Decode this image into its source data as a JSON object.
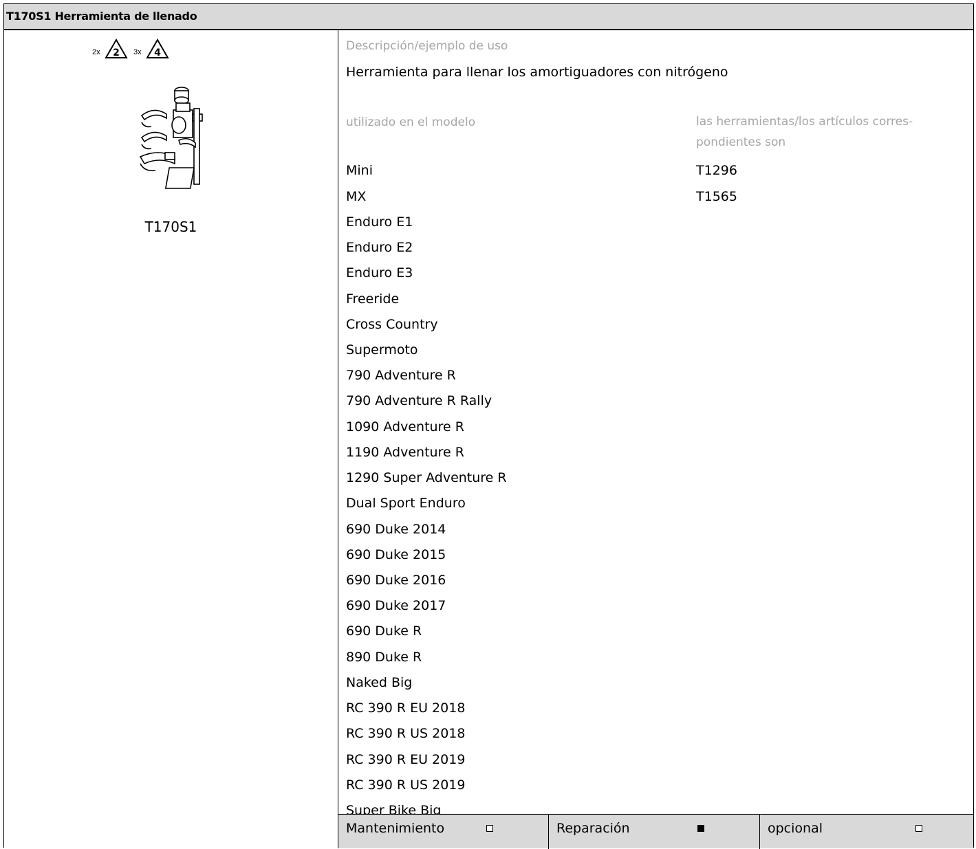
{
  "header": {
    "title": "T170S1 Herramienta de llenado"
  },
  "tool": {
    "warning_icons": [
      {
        "multiplier": "2x",
        "number": "2"
      },
      {
        "multiplier": "3x",
        "number": "4"
      }
    ],
    "name": "T170S1"
  },
  "description": {
    "label": "Descripción/ejemplo de uso",
    "value": "Herramienta para llenar los amortiguadores con nitrógeno"
  },
  "used_in": {
    "label": "utilizado en el modelo",
    "models": [
      "Mini",
      "MX",
      "Enduro E1",
      "Enduro E2",
      "Enduro E3",
      "Freeride",
      "Cross Country",
      "Supermoto",
      "790 Adventure R",
      "790 Adventure R Rally",
      "1090 Adventure R",
      "1190 Adventure R",
      "1290 Super Adventure R",
      "Dual Sport Enduro",
      "690 Duke 2014",
      "690 Duke 2015",
      "690 Duke 2016",
      "690 Duke 2017",
      "690 Duke R",
      "890 Duke R",
      "Naked Big",
      "RC 390 R EU 2018",
      "RC 390 R US 2018",
      "RC 390 R EU 2019",
      "RC 390 R US 2019",
      "Super Bike Big"
    ]
  },
  "corresponding": {
    "label_line1": "las herramientas/los artículos corres-",
    "label_line2": "pondientes son",
    "items": [
      "T1296",
      "T1565"
    ]
  },
  "footer": {
    "cells": [
      {
        "label": "Mantenimiento",
        "checked": false
      },
      {
        "label": "Reparación",
        "checked": true
      },
      {
        "label": "opcional",
        "checked": false
      }
    ]
  }
}
